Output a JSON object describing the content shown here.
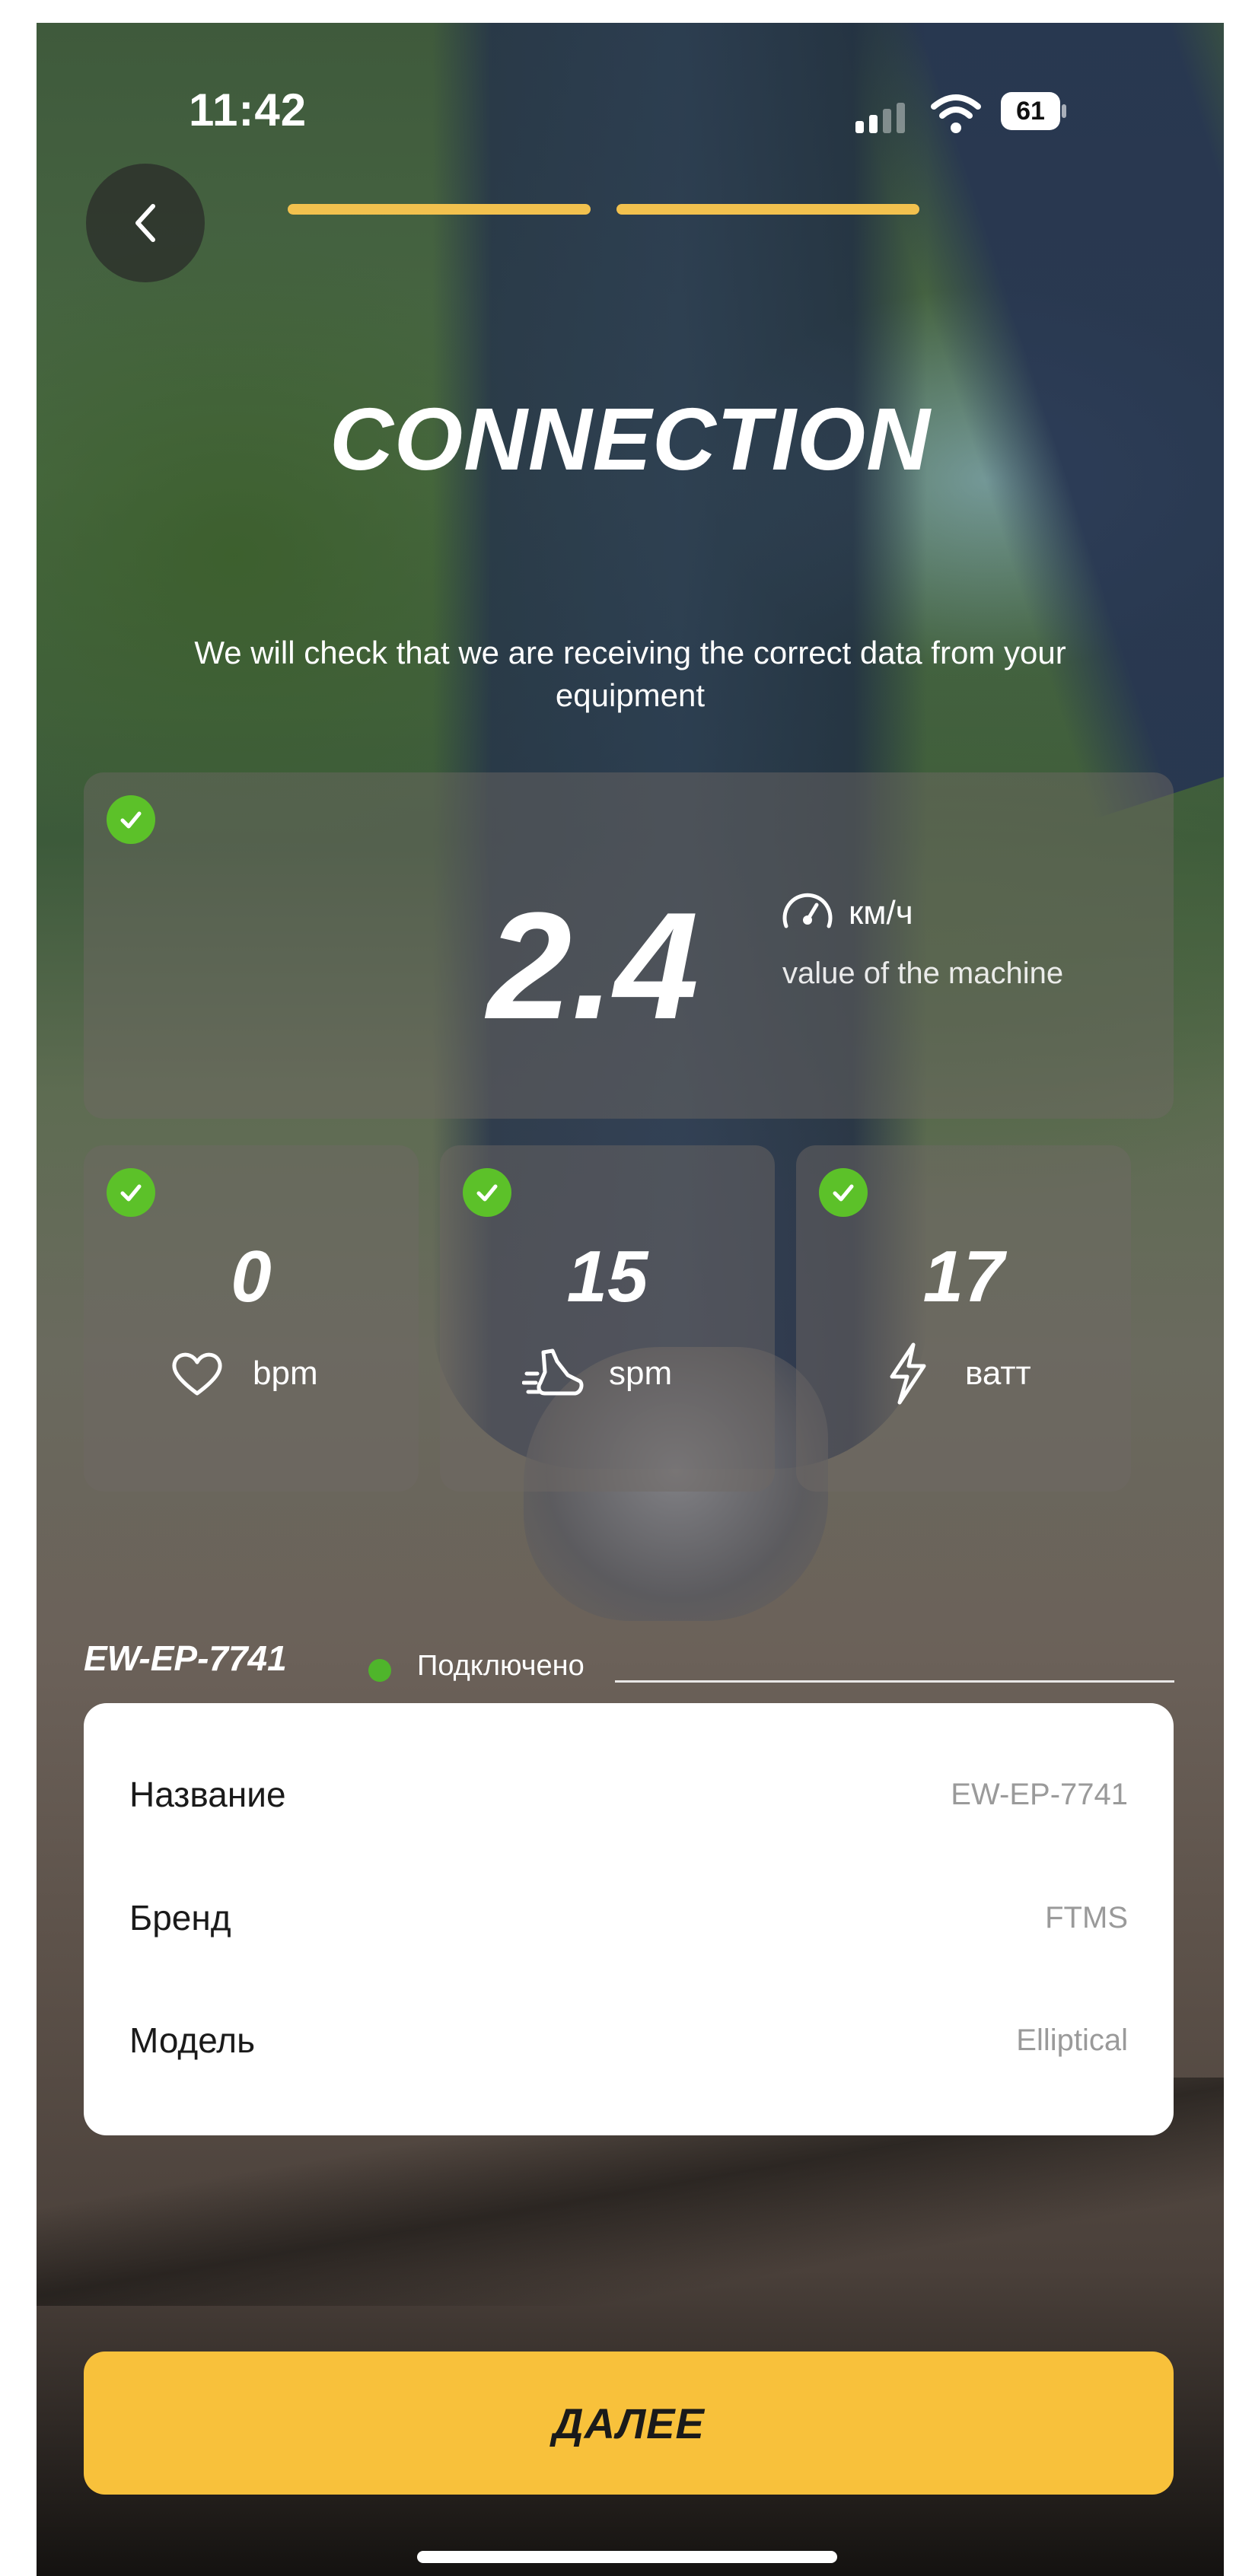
{
  "status_bar": {
    "time": "11:42",
    "battery_level": "61"
  },
  "header": {
    "back_icon": "chevron-left-icon",
    "progress_steps": 2,
    "progress_color": "#f2c14e",
    "title": "CONNECTION",
    "subtitle": "We will check that we are receiving the correct data from your equipment"
  },
  "speed_card": {
    "value": "2.4",
    "unit": "км/ч",
    "caption": "value of the machine",
    "icon": "speedometer-icon",
    "status_icon": "check-circle-icon"
  },
  "metrics": [
    {
      "value": "0",
      "unit": "bpm",
      "icon": "heart-icon"
    },
    {
      "value": "15",
      "unit": "spm",
      "icon": "running-shoe-icon"
    },
    {
      "value": "17",
      "unit": "ватт",
      "icon": "lightning-icon"
    }
  ],
  "device": {
    "name": "EW-EP-7741",
    "status": "Подключено",
    "status_color": "#4fb52b",
    "rows": [
      {
        "label": "Название",
        "value": "EW-EP-7741"
      },
      {
        "label": "Бренд",
        "value": "FTMS"
      },
      {
        "label": "Модель",
        "value": "Elliptical"
      }
    ]
  },
  "footer": {
    "next_label": "ДАЛЕЕ",
    "accent_color": "#f8c13b"
  }
}
